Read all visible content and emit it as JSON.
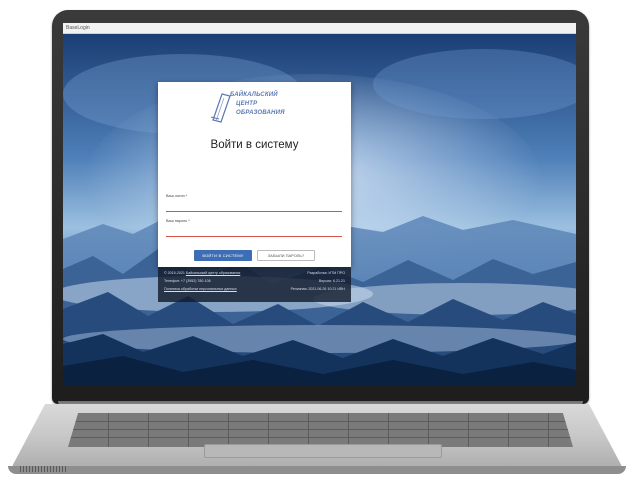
{
  "window": {
    "title": "BaseLogin"
  },
  "login": {
    "logo_lines": [
      "БАЙКАЛЬСКИЙ",
      "ЦЕНТР",
      "ОБРАЗОВАНИЯ"
    ],
    "heading": "Войти в систему",
    "login_label": "Ваш логин *",
    "login_value": "",
    "password_label": "Ваш пароль *",
    "password_value": "",
    "login_button": "ВОЙТИ В СИСТЕМУ",
    "forgot_button": "ЗАБЫЛИ ПАРОЛЬ?"
  },
  "footer": {
    "copyright_prefix": "© 2015-2021",
    "copyright_link": "Байкальский центр образования",
    "phone": "Телефон: +7 (3952) 780-106",
    "policy": "Политика обработки персональных данных",
    "developer": "Разработка: ИТМ ПРО",
    "version": "Версия: 6.21.21",
    "release": "Релизная: 2021.06.26 10:21 ИВН"
  },
  "colors": {
    "accent": "#3d6db5",
    "field_underline": "#d9534f",
    "logo": "#5b78b4",
    "footer_bg": "#141c2d"
  }
}
